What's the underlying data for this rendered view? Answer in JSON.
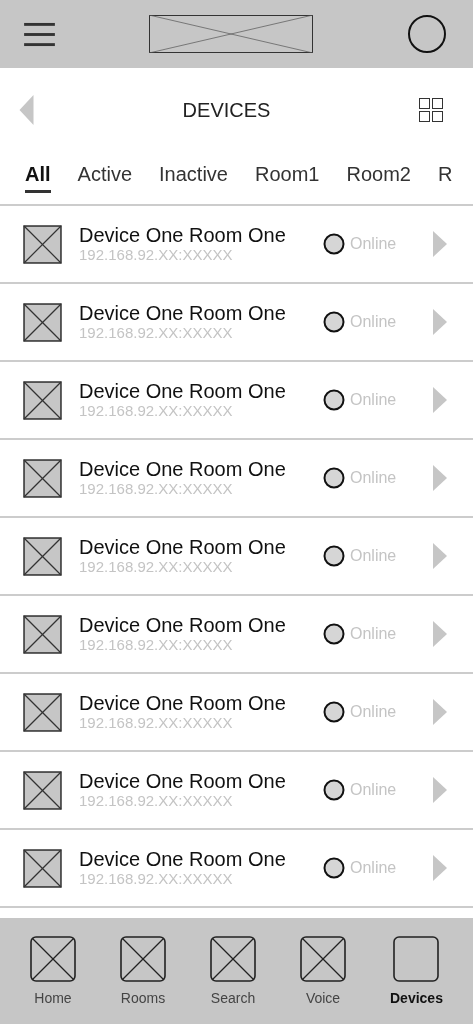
{
  "header": {
    "title": "DEVICES"
  },
  "tabs": [
    {
      "label": "All",
      "selected": true
    },
    {
      "label": "Active",
      "selected": false
    },
    {
      "label": "Inactive",
      "selected": false
    },
    {
      "label": "Room1",
      "selected": false
    },
    {
      "label": "Room2",
      "selected": false
    },
    {
      "label": "R",
      "selected": false
    }
  ],
  "devices": [
    {
      "name": "Device One Room One",
      "address": "192.168.92.XX:XXXXX",
      "status": "Online"
    },
    {
      "name": "Device One Room One",
      "address": "192.168.92.XX:XXXXX",
      "status": "Online"
    },
    {
      "name": "Device One Room One",
      "address": "192.168.92.XX:XXXXX",
      "status": "Online"
    },
    {
      "name": "Device One Room One",
      "address": "192.168.92.XX:XXXXX",
      "status": "Online"
    },
    {
      "name": "Device One Room One",
      "address": "192.168.92.XX:XXXXX",
      "status": "Online"
    },
    {
      "name": "Device One Room One",
      "address": "192.168.92.XX:XXXXX",
      "status": "Online"
    },
    {
      "name": "Device One Room One",
      "address": "192.168.92.XX:XXXXX",
      "status": "Online"
    },
    {
      "name": "Device One Room One",
      "address": "192.168.92.XX:XXXXX",
      "status": "Online"
    },
    {
      "name": "Device One Room One",
      "address": "192.168.92.XX:XXXXX",
      "status": "Online"
    }
  ],
  "bottom_nav": [
    {
      "label": "Home",
      "selected": false
    },
    {
      "label": "Rooms",
      "selected": false
    },
    {
      "label": "Search",
      "selected": false
    },
    {
      "label": "Voice",
      "selected": false
    },
    {
      "label": "Devices",
      "selected": true
    }
  ]
}
